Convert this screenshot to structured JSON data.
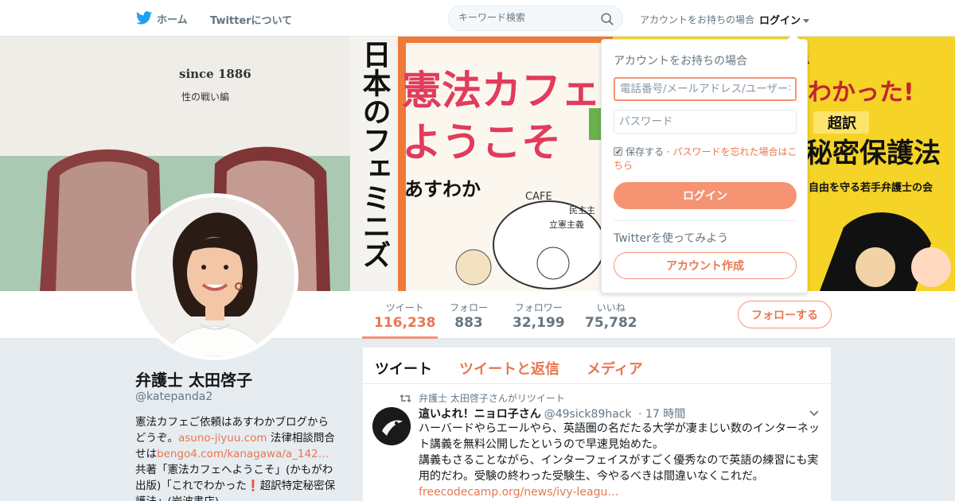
{
  "topbar": {
    "home_label": "ホーム",
    "about_label": "Twitterについて",
    "search_placeholder": "キーワード検索",
    "have_account_text": "アカウントをお持ちの場合",
    "login_label": "ログイン"
  },
  "colors": {
    "accent": "#f59372",
    "accent_text": "#e8774f",
    "twitter_blue": "#1da1f2"
  },
  "banner": {
    "book1_since": "since 1886",
    "book1_sub": "性の戦い編",
    "book2_spine": "日本のフェミニズ",
    "book3_title_line1": "憲法カフェ",
    "book3_title_line2": "ようこそ",
    "book3_author": "あすわか",
    "book3_cafe": "CAFE",
    "book3_cup1": "民主主",
    "book3_cup2": "立憲主義",
    "book4_top1": "で",
    "book4_top2": "わかった!",
    "book4_tag": "超訳",
    "book4_title": "秘密保護法",
    "book4_sub": "自由を守る若手弁護士の会"
  },
  "profile_nav": {
    "stats": [
      {
        "label": "ツイート",
        "value": "116,238"
      },
      {
        "label": "フォロー",
        "value": "883"
      },
      {
        "label": "フォロワー",
        "value": "32,199"
      },
      {
        "label": "いいね",
        "value": "75,782"
      }
    ],
    "follow_button": "フォローする"
  },
  "profile": {
    "name": "弁護士 太田啓子",
    "handle": "@katepanda2",
    "bio_part1": "憲法カフェご依頼はあすわかブログからどうぞ。",
    "bio_link1": "asuno-jiyuu.com",
    "bio_part2": " 法律相談問合せは",
    "bio_link2": "bengo4.com/kanagawa/a_142…",
    "bio_part3": " 共著「憲法カフェへようこそ」(かもがわ出版)「これでわかった",
    "bio_mark": "❗",
    "bio_part4": "超訳特定秘密保護法」(岩波書店)"
  },
  "timeline": {
    "tabs": [
      "ツイート",
      "ツイートと返信",
      "メディア"
    ],
    "retweet_context": "弁護士 太田啓子さんがリツイート",
    "tweet": {
      "author_name": "這いよれ！ニョロ子さん",
      "author_handle": "@49sick89hack",
      "time": "· 17 時間",
      "line1": "ハーバードやらエールやら、英語圏の名だたる大学が凄まじい数のインターネット講義を無料公開したというので早速見始めた。",
      "line2": "講義もさることながら、インターフェイスがすごく優秀なので英語の練習にも実用的だわ。受験の終わった受験生、今やるべきは間違いなくこれだ。",
      "link": "freecodecamp.org/news/ivy-leagu…"
    }
  },
  "login_dropdown": {
    "title": "アカウントをお持ちの場合",
    "username_placeholder": "電話番号/メールアドレス/ユーザー名",
    "password_placeholder": "パスワード",
    "remember_label": "保存する",
    "separator": " · ",
    "forgot_link": "パスワードを忘れた場合はこちら",
    "login_button": "ログイン",
    "try_text": "Twitterを使ってみよう",
    "signup_button": "アカウント作成"
  }
}
